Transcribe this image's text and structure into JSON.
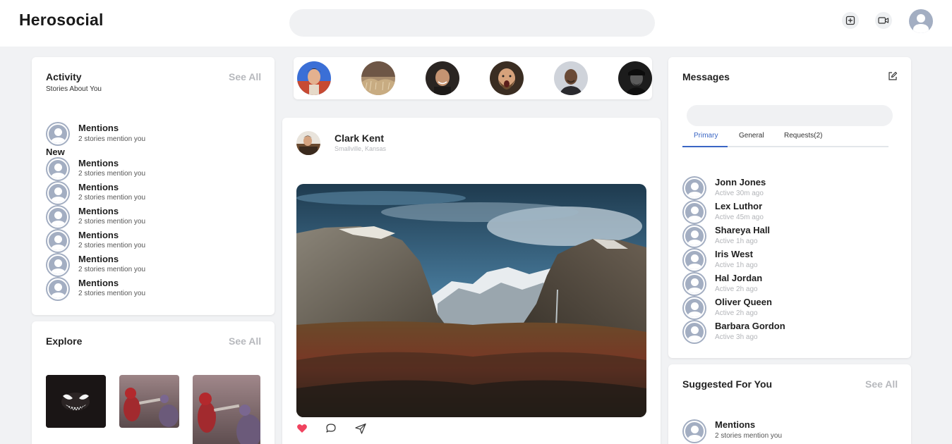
{
  "app": {
    "logo": "Herosocial"
  },
  "header": {
    "search_placeholder": "",
    "icons": [
      "add-square-icon",
      "video-icon",
      "user-avatar-icon"
    ]
  },
  "activity": {
    "title": "Activity",
    "subtitle": "Stories About You",
    "see_all": "See All",
    "new_label": "New",
    "items": [
      {
        "name": "Mentions",
        "sub": "2 stories mention you"
      },
      {
        "name": "Mentions",
        "sub": "2 stories mention you"
      },
      {
        "name": "Mentions",
        "sub": "2 stories mention you"
      },
      {
        "name": "Mentions",
        "sub": "2 stories mention you"
      },
      {
        "name": "Mentions",
        "sub": "2 stories mention you"
      },
      {
        "name": "Mentions",
        "sub": "2 stories mention you"
      },
      {
        "name": "Mentions",
        "sub": "2 stories mention you"
      }
    ]
  },
  "explore": {
    "title": "Explore",
    "see_all": "See All"
  },
  "post": {
    "author": "Clark Kent",
    "location": "Smallville, Kansas",
    "actions": [
      "heart-icon",
      "comment-icon",
      "send-icon"
    ]
  },
  "messages": {
    "title": "Messages",
    "search_placeholder": "",
    "tabs": [
      "Primary",
      "General",
      "Requests(2)"
    ],
    "active_tab": "Primary",
    "contacts": [
      {
        "name": "Jonn Jones",
        "status": "Active 30m ago"
      },
      {
        "name": "Lex Luthor",
        "status": "Active 45m ago"
      },
      {
        "name": "Shareya Hall",
        "status": "Active 1h ago"
      },
      {
        "name": "Iris West",
        "status": "Active 1h ago"
      },
      {
        "name": "Hal Jordan",
        "status": "Active 2h ago"
      },
      {
        "name": "Oliver Queen",
        "status": "Active 2h ago"
      },
      {
        "name": "Barbara Gordon",
        "status": "Active 3h ago"
      }
    ]
  },
  "suggested": {
    "title": "Suggested For You",
    "see_all": "See All",
    "items": [
      {
        "name": "Mentions",
        "sub": "2 stories mention you"
      }
    ]
  },
  "colors": {
    "accent": "#3a66c4",
    "heart": "#f0435f",
    "avatar_bg": "#a3aec2",
    "page_bg": "#f1f2f4"
  }
}
